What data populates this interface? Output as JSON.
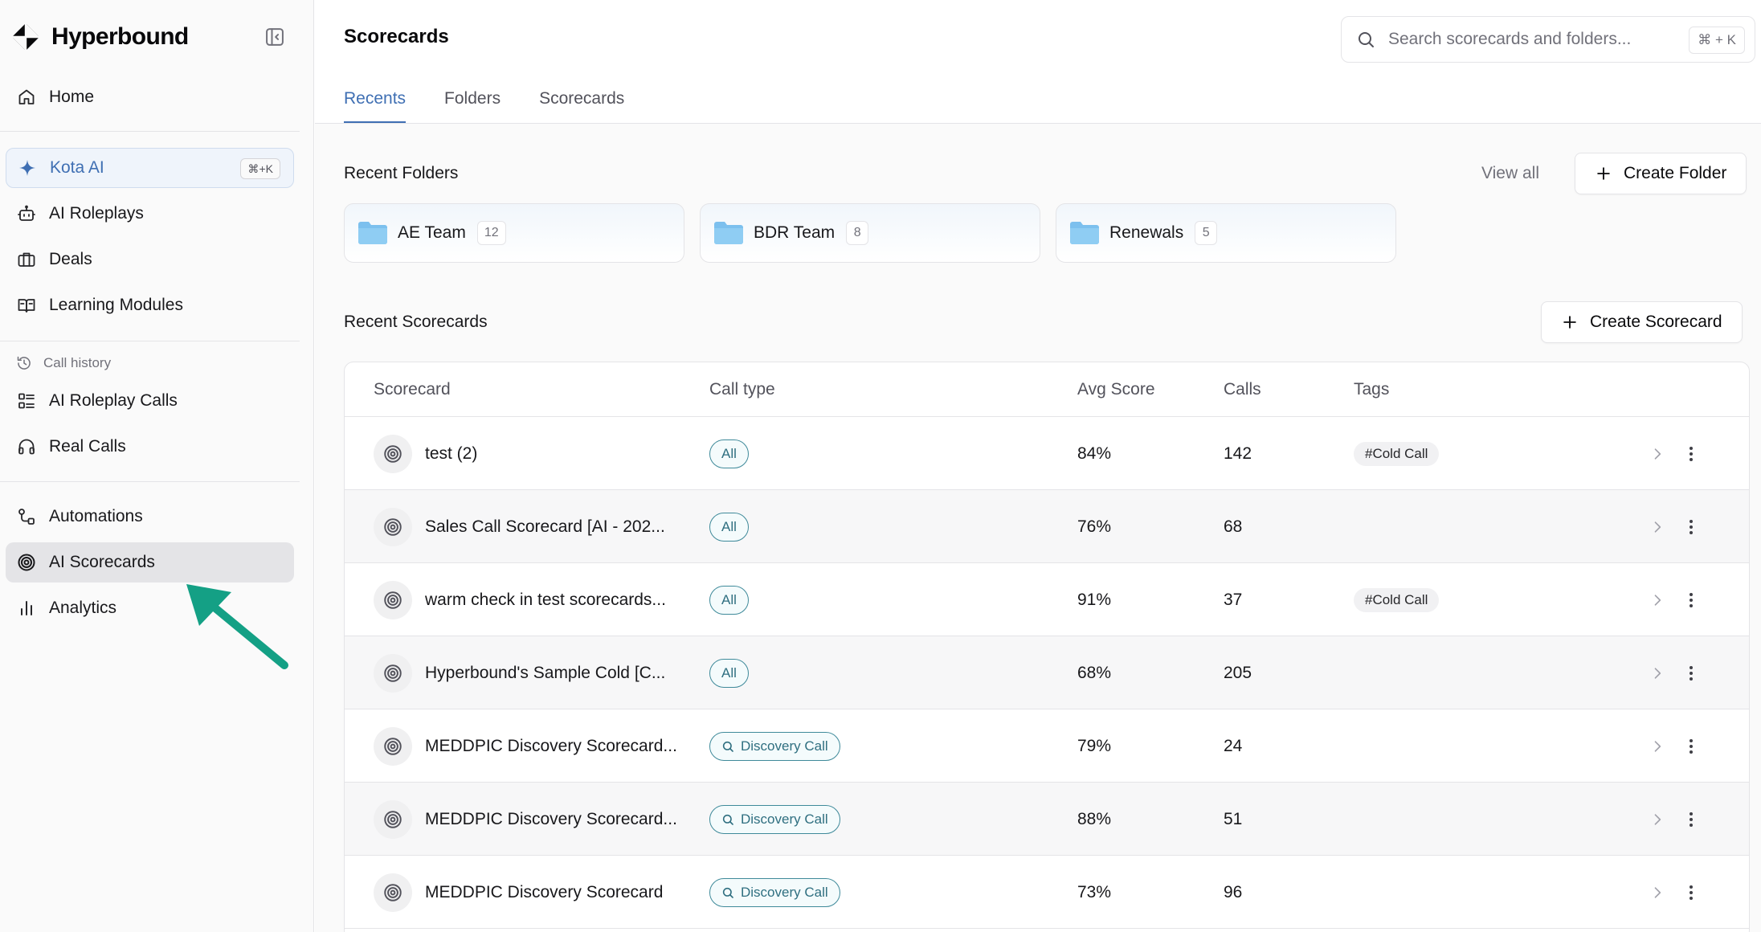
{
  "brand": {
    "name": "Hyperbound"
  },
  "nav": {
    "home": "Home",
    "kota": {
      "label": "Kota AI",
      "shortcut": "⌘+K"
    },
    "roleplays": "AI Roleplays",
    "deals": "Deals",
    "learning": "Learning Modules",
    "call_history_label": "Call history",
    "roleplay_calls": "AI Roleplay Calls",
    "real_calls": "Real Calls",
    "automations": "Automations",
    "scorecards": "AI Scorecards",
    "analytics": "Analytics"
  },
  "header": {
    "title": "Scorecards",
    "search_placeholder": "Search scorecards and folders...",
    "search_shortcut": "⌘ + K"
  },
  "tabs": [
    {
      "label": "Recents",
      "active": true
    },
    {
      "label": "Folders",
      "active": false
    },
    {
      "label": "Scorecards",
      "active": false
    }
  ],
  "recent_folders": {
    "title": "Recent Folders",
    "view_all": "View all",
    "create_label": "Create Folder",
    "items": [
      {
        "name": "AE Team",
        "count": "12"
      },
      {
        "name": "BDR Team",
        "count": "8"
      },
      {
        "name": "Renewals",
        "count": "5"
      }
    ]
  },
  "recent_scorecards": {
    "title": "Recent Scorecards",
    "create_label": "Create Scorecard",
    "columns": {
      "scorecard": "Scorecard",
      "call_type": "Call type",
      "avg_score": "Avg Score",
      "calls": "Calls",
      "tags": "Tags"
    },
    "rows": [
      {
        "name": "test (2)",
        "call_type": "All",
        "avg": "84%",
        "calls": "142",
        "tag": "#Cold Call"
      },
      {
        "name": "Sales Call Scorecard [AI - 202...",
        "call_type": "All",
        "avg": "76%",
        "calls": "68",
        "tag": ""
      },
      {
        "name": "warm check in test scorecards...",
        "call_type": "All",
        "avg": "91%",
        "calls": "37",
        "tag": "#Cold Call"
      },
      {
        "name": "Hyperbound's Sample Cold [C...",
        "call_type": "All",
        "avg": "68%",
        "calls": "205",
        "tag": ""
      },
      {
        "name": "MEDDPIC Discovery Scorecard...",
        "call_type": "Discovery Call",
        "avg": "79%",
        "calls": "24",
        "tag": ""
      },
      {
        "name": "MEDDPIC Discovery Scorecard...",
        "call_type": "Discovery Call",
        "avg": "88%",
        "calls": "51",
        "tag": ""
      },
      {
        "name": "MEDDPIC Discovery Scorecard",
        "call_type": "Discovery Call",
        "avg": "73%",
        "calls": "96",
        "tag": ""
      }
    ]
  },
  "colors": {
    "accent": "#3f6fb3",
    "pill": "#3f8a9a",
    "arrow": "#14a085",
    "folder": "#7cc0ee"
  }
}
